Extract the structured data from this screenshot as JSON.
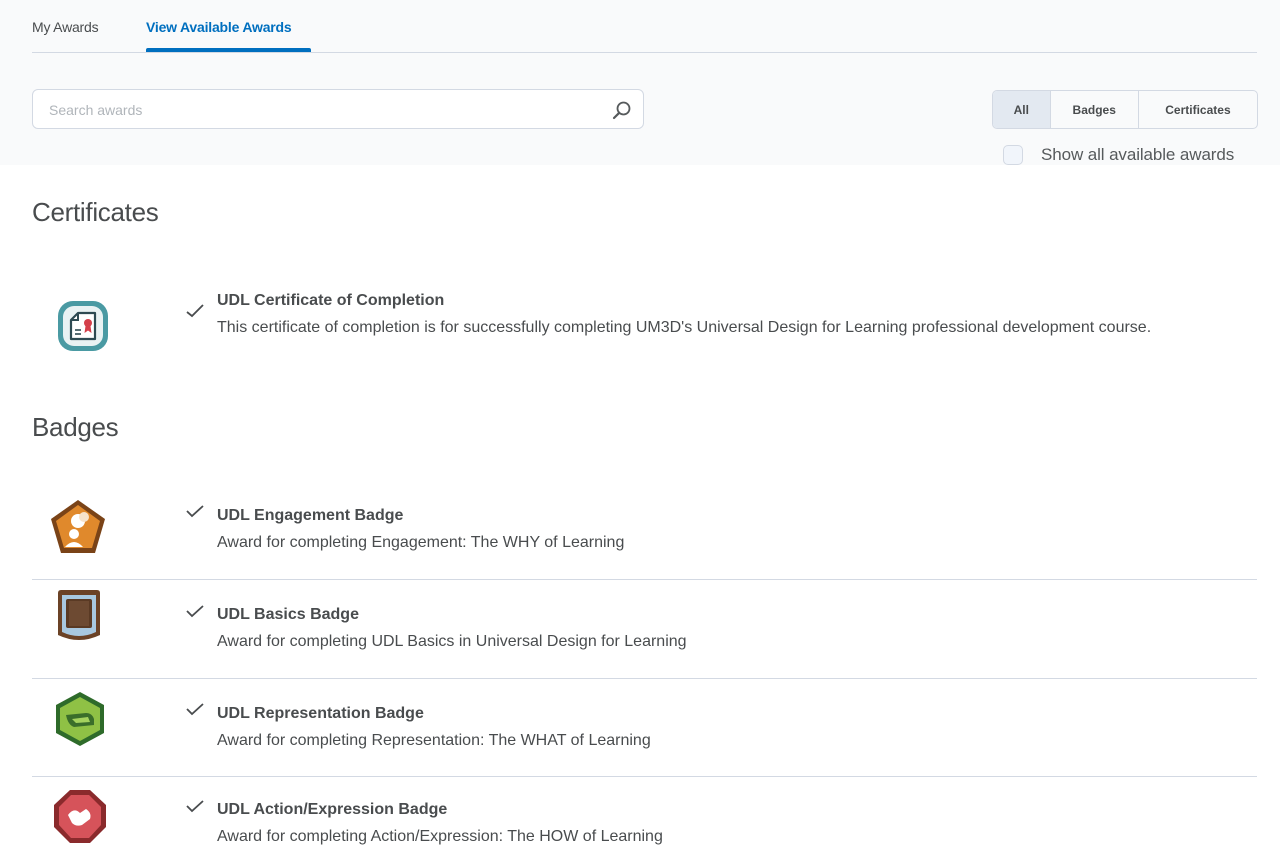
{
  "tabs": [
    {
      "label": "My Awards"
    },
    {
      "label": "View Available Awards"
    }
  ],
  "search": {
    "placeholder": "Search awards",
    "value": ""
  },
  "filters": [
    {
      "label": "All",
      "selected": true
    },
    {
      "label": "Badges",
      "selected": false
    },
    {
      "label": "Certificates",
      "selected": false
    }
  ],
  "show_all": {
    "label": "Show all available awards",
    "checked": false
  },
  "certificates": {
    "heading": "Certificates",
    "items": [
      {
        "name": "UDL Certificate of Completion",
        "description": "This certificate of completion is for successfully completing UM3D's Universal Design for Learning professional development course.",
        "icon": "certificate-icon",
        "completed": true
      }
    ]
  },
  "badges": {
    "heading": "Badges",
    "items": [
      {
        "name": "UDL Engagement Badge",
        "description": "Award for completing Engagement: The WHY of Learning",
        "icon": "engagement-badge-icon",
        "color": "#c8741f",
        "completed": true
      },
      {
        "name": "UDL Basics Badge",
        "description": "Award for completing UDL Basics in Universal Design for Learning",
        "icon": "basics-badge-icon",
        "color": "#7a4e2d",
        "completed": true
      },
      {
        "name": "UDL Representation Badge",
        "description": "Award for completing Representation: The WHAT of Learning",
        "icon": "representation-badge-icon",
        "color": "#6fae3a",
        "completed": true
      },
      {
        "name": "UDL Action/Expression Badge",
        "description": "Award for completing Action/Expression: The HOW of Learning",
        "icon": "action-expression-badge-icon",
        "color": "#c8474a",
        "completed": true
      }
    ]
  },
  "colors": {
    "accent": "#006fbf",
    "text": "#494c4e",
    "border": "#d3d9e3",
    "certificate_teal": "#4a9aa3"
  }
}
